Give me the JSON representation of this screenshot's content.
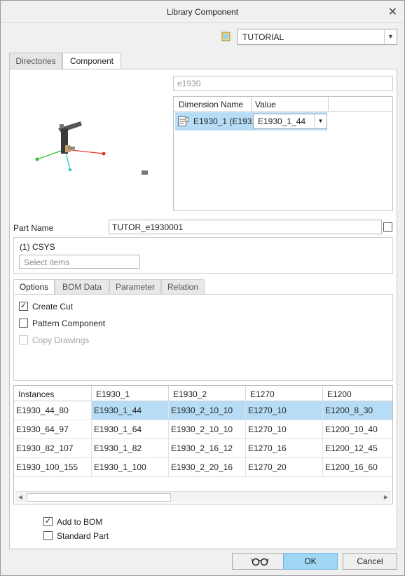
{
  "window": {
    "title": "Library Component"
  },
  "library_select": {
    "value": "TUTORIAL"
  },
  "tabs": [
    {
      "label": "Directories"
    },
    {
      "label": "Component"
    }
  ],
  "component": {
    "name_placeholder": "e1930",
    "dimension_table": {
      "headers": [
        "Dimension Name",
        "Value"
      ],
      "rows": [
        {
          "name": "E1930_1 (E193...",
          "value": "E1930_1_44"
        }
      ]
    }
  },
  "part_name": {
    "label": "Part Name",
    "value": "TUTOR_e1930001"
  },
  "csys": {
    "label": "(1) CSYS",
    "select_placeholder": "Select items"
  },
  "subtabs": [
    {
      "label": "Options"
    },
    {
      "label": "BOM Data"
    },
    {
      "label": "Parameter"
    },
    {
      "label": "Relation"
    }
  ],
  "options": {
    "create_cut": {
      "label": "Create Cut",
      "checked": true
    },
    "pattern_component": {
      "label": "Pattern Component",
      "checked": false
    },
    "copy_drawings": {
      "label": "Copy Drawings",
      "checked": false,
      "disabled": true
    }
  },
  "instances": {
    "headers": [
      "Instances",
      "E1930_1",
      "E1930_2",
      "E1270",
      "E1200"
    ],
    "rows": [
      [
        "E1930_44_80",
        "E1930_1_44",
        "E1930_2_10_10",
        "E1270_10",
        "E1200_8_30"
      ],
      [
        "E1930_64_97",
        "E1930_1_64",
        "E1930_2_10_10",
        "E1270_10",
        "E1200_10_40"
      ],
      [
        "E1930_82_107",
        "E1930_1_82",
        "E1930_2_16_12",
        "E1270_16",
        "E1200_12_45"
      ],
      [
        "E1930_100_155",
        "E1930_1_100",
        "E1930_2_20_16",
        "E1270_20",
        "E1200_16_60"
      ]
    ],
    "selected_row": 0
  },
  "add_to_bom": {
    "label": "Add to BOM",
    "checked": true
  },
  "standard_part": {
    "label": "Standard Part",
    "checked": false
  },
  "buttons": {
    "ok": "OK",
    "cancel": "Cancel"
  },
  "colors": {
    "selection": "#b6ddf5",
    "ok_button": "#9fd7f4"
  }
}
